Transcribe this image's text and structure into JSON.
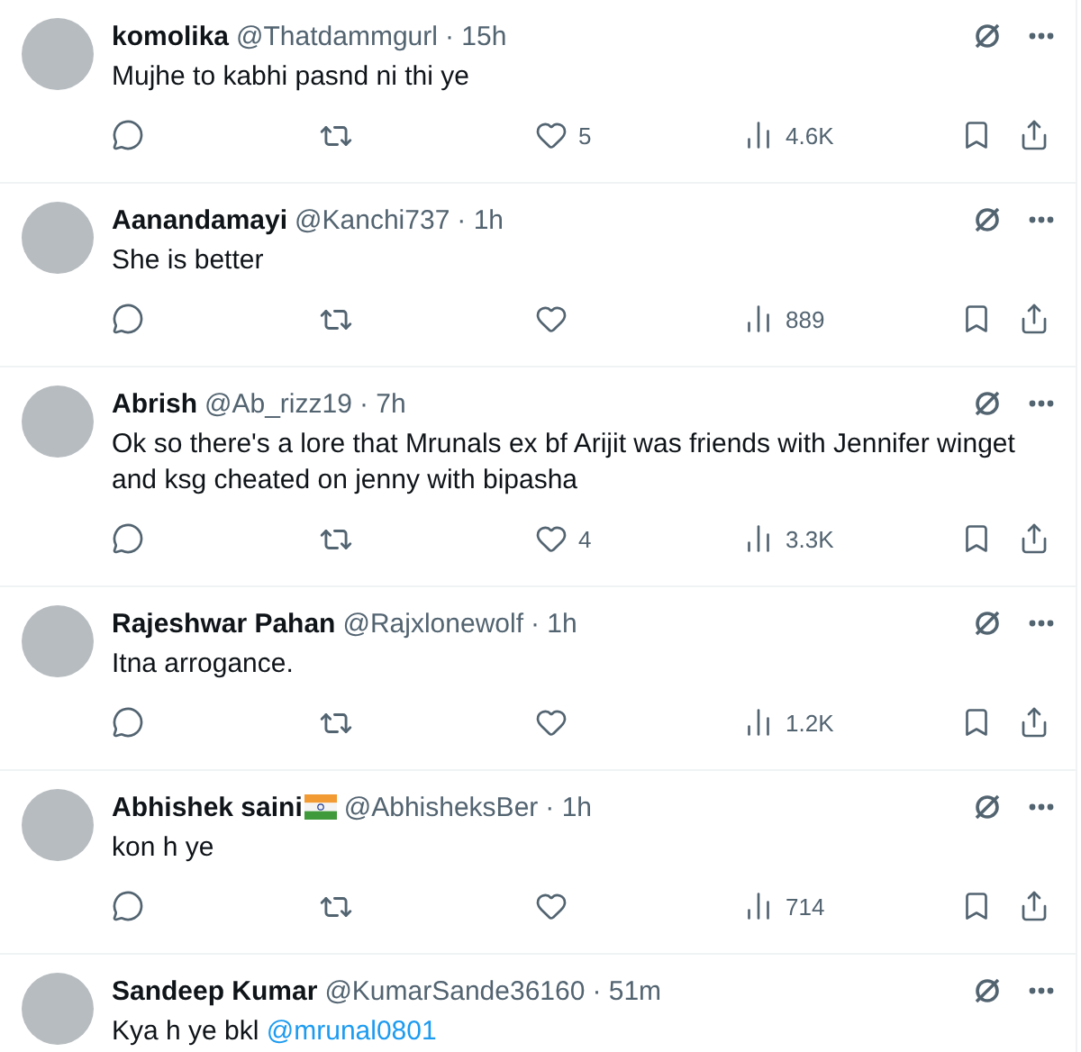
{
  "replies": [
    {
      "name": "komolika",
      "handle": "@Thatdammgurl",
      "time": "· 15h",
      "text": [
        {
          "kind": "text",
          "value": "Mujhe to kabhi pasnd ni thi ye"
        }
      ],
      "stats": {
        "likes": "5",
        "views": "4.6K"
      }
    },
    {
      "name": "Aanandamayi",
      "handle": "@Kanchi737",
      "time": "· 1h",
      "text": [
        {
          "kind": "text",
          "value": "She is better"
        }
      ],
      "stats": {
        "views": "889"
      }
    },
    {
      "name": "Abrish",
      "handle": "@Ab_rizz19",
      "time": "· 7h",
      "text": [
        {
          "kind": "text",
          "value": "Ok so there's a lore that Mrunals ex bf Arijit was friends with Jennifer winget and ksg cheated on jenny with bipasha"
        }
      ],
      "stats": {
        "likes": "4",
        "views": "3.3K"
      }
    },
    {
      "name": "Rajeshwar Pahan",
      "handle": "@Rajxlonewolf",
      "time": "· 1h",
      "text": [
        {
          "kind": "text",
          "value": "Itna arrogance."
        }
      ],
      "stats": {
        "views": "1.2K"
      }
    },
    {
      "name": "Abhishek saini",
      "flag": true,
      "handle": "@AbhisheksBer",
      "time": "· 1h",
      "text": [
        {
          "kind": "text",
          "value": "kon h ye"
        }
      ],
      "stats": {
        "views": "714"
      }
    },
    {
      "name": "Sandeep Kumar",
      "handle": "@KumarSande36160",
      "time": "· 51m",
      "text": [
        {
          "kind": "text",
          "value": "Kya h ye bkl "
        },
        {
          "kind": "mention",
          "value": "@mrunal0801"
        }
      ]
    }
  ]
}
